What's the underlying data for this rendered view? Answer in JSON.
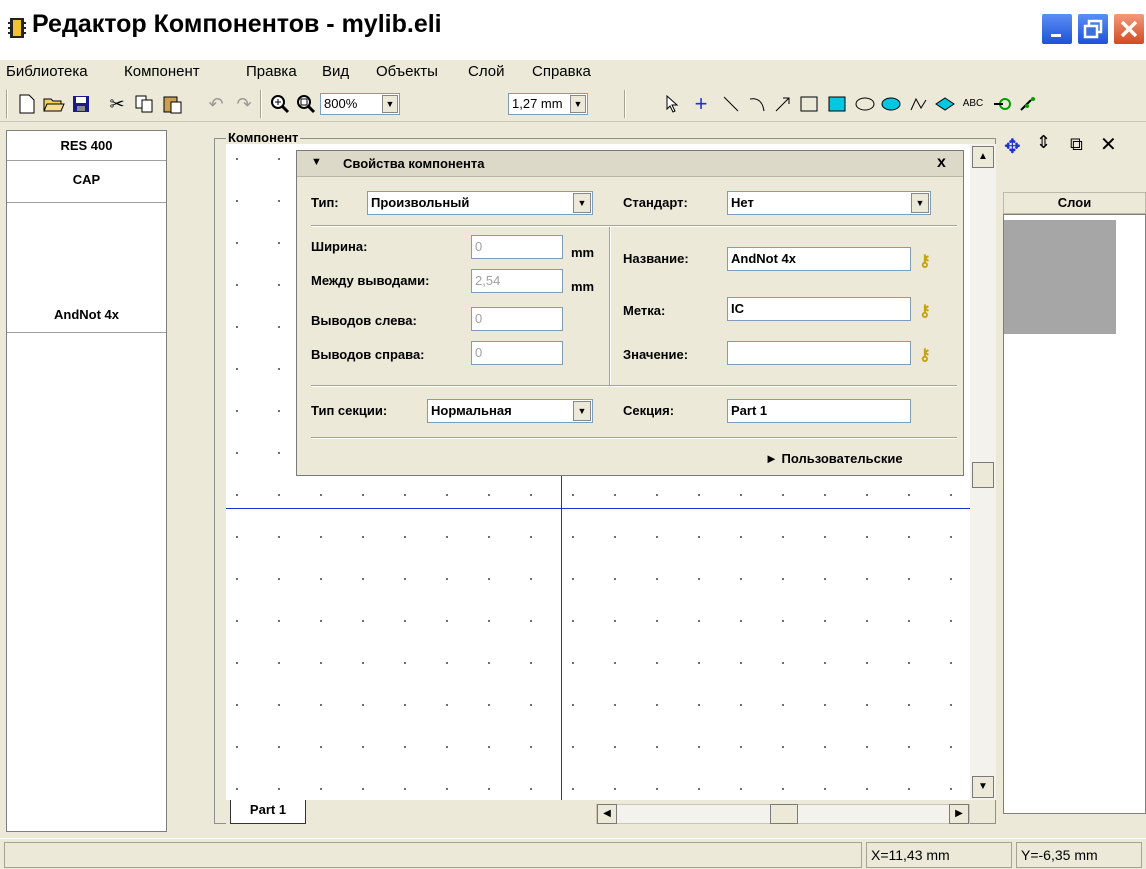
{
  "window": {
    "title": "Редактор Компонентов - mylib.eli"
  },
  "menu": [
    "Библиотека",
    "Компонент",
    "Правка",
    "Вид",
    "Объекты",
    "Слой",
    "Справка"
  ],
  "toolbar": {
    "zoom": "800%",
    "grid": "1,27 mm",
    "text_tool": "ABC"
  },
  "components": [
    {
      "label": "RES 400"
    },
    {
      "label": "CAP"
    },
    {
      "label": "AndNot 4x"
    }
  ],
  "editor": {
    "frame_label": "Компонент",
    "tabs": [
      "Part 1"
    ]
  },
  "properties": {
    "title": "Свойства компонента",
    "close": "x",
    "type_label": "Тип:",
    "type_value": "Произвольный",
    "standard_label": "Стандарт:",
    "standard_value": "Нет",
    "width_label": "Ширина:",
    "width_value": "0",
    "width_unit": "mm",
    "pitch_label": "Между выводами:",
    "pitch_value": "2,54",
    "pitch_unit": "mm",
    "left_pins_label": "Выводов слева:",
    "left_pins_value": "0",
    "right_pins_label": "Выводов справа:",
    "right_pins_value": "0",
    "name_label": "Название:",
    "name_value": "AndNot 4x",
    "mark_label": "Метка:",
    "mark_value": "IC",
    "value_label": "Значение:",
    "value_value": "",
    "section_type_label": "Тип секции:",
    "section_type_value": "Нормальная",
    "section_label": "Секция:",
    "section_value": "Part 1",
    "custom": "► Пользовательские"
  },
  "layers": {
    "header": "Слои"
  },
  "status": {
    "x": "X=11,43 mm",
    "y": "Y=-6,35 mm"
  }
}
